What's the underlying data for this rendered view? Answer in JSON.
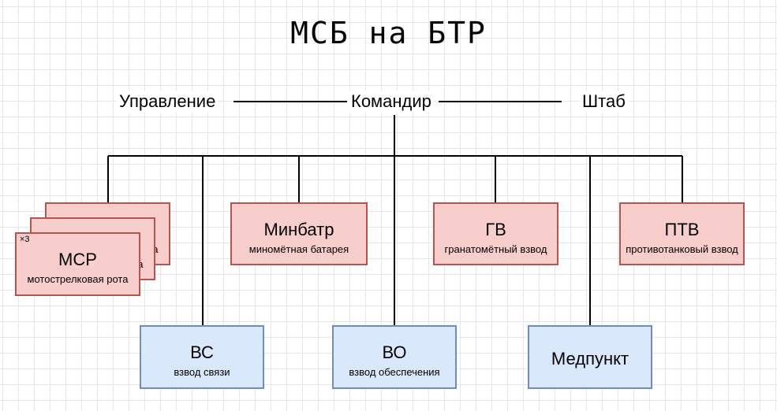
{
  "title": "МСБ на БТР",
  "top": {
    "left": "Управление",
    "center": "Командир",
    "right": "Штаб"
  },
  "units": {
    "msr": {
      "name": "МСР",
      "sub": "мотострелковая рота",
      "multiplier": "×3"
    },
    "minbatr": {
      "name": "Минбатр",
      "sub": "миномётная батарея"
    },
    "gv": {
      "name": "ГВ",
      "sub": "гранатомётный взвод"
    },
    "ptv": {
      "name": "ПТВ",
      "sub": "противотанковый взвод"
    },
    "vs": {
      "name": "ВС",
      "sub": "взвод связи"
    },
    "vo": {
      "name": "ВО",
      "sub": "взвод обеспечения"
    },
    "medpunkt": {
      "name": "Медпункт"
    }
  },
  "colors": {
    "red_fill": "#f8cecc",
    "red_stroke": "#b85450",
    "blue_fill": "#dae8fc",
    "blue_stroke": "#6c8ebf"
  }
}
